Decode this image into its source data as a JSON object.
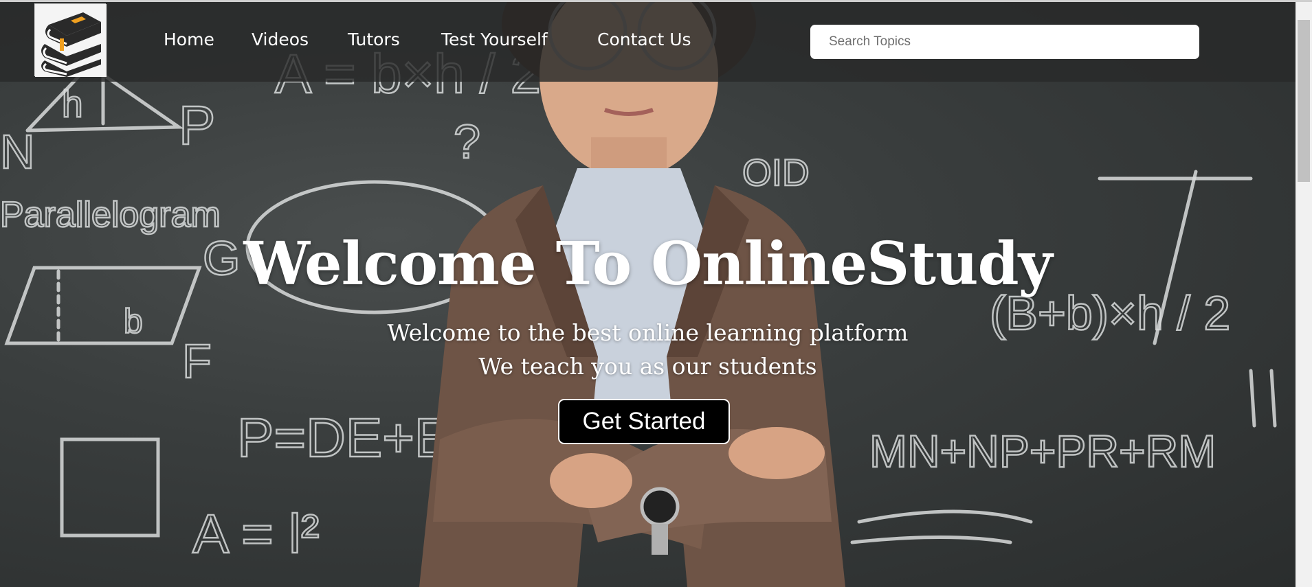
{
  "nav": {
    "links": [
      {
        "label": "Home"
      },
      {
        "label": "Videos"
      },
      {
        "label": "Tutors"
      },
      {
        "label": "Test Yourself"
      },
      {
        "label": "Contact Us"
      }
    ],
    "search": {
      "placeholder": "Search Topics",
      "value": ""
    },
    "logo_icon": "books-stack-icon"
  },
  "hero": {
    "title": "Welcome To OnlineStudy",
    "subtitle_1": "Welcome to the best online learning platform",
    "subtitle_2": "We teach you as our students",
    "cta_label": "Get Started"
  },
  "colors": {
    "nav_bg": "#2a2c2c",
    "button_bg": "#000000",
    "text": "#ffffff",
    "chalkboard": "#3a3e3e",
    "book_accent": "#f0a020"
  },
  "chalkboard": {
    "labels": [
      "Parallelogram",
      "A = b×h / 2",
      "P",
      "N",
      "(B+b)×h / 2",
      "MN+NP+PR+RM",
      "P=DE+EF",
      "A = l²",
      "OID",
      "?",
      "h",
      "b",
      "F",
      "G"
    ]
  }
}
